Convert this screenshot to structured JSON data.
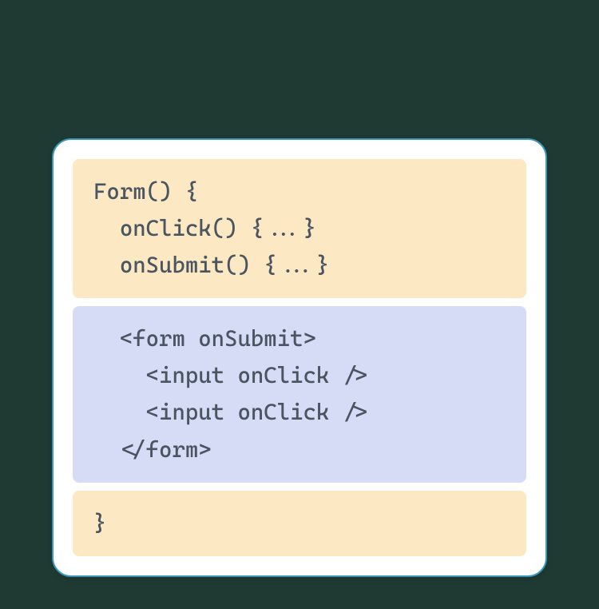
{
  "colors": {
    "background": "#1e3a33",
    "card_bg": "#ffffff",
    "card_border": "#3a96b8",
    "block_yellow": "#fce8c2",
    "block_blue": "#d7dcf6",
    "text": "#4a5562"
  },
  "blocks": {
    "top": "Form() {\n  onClick() {...}\n  onSubmit() {...}",
    "middle": "  <form onSubmit>\n    <input onClick />\n    <input onClick />\n  </form>",
    "bottom": "}"
  }
}
